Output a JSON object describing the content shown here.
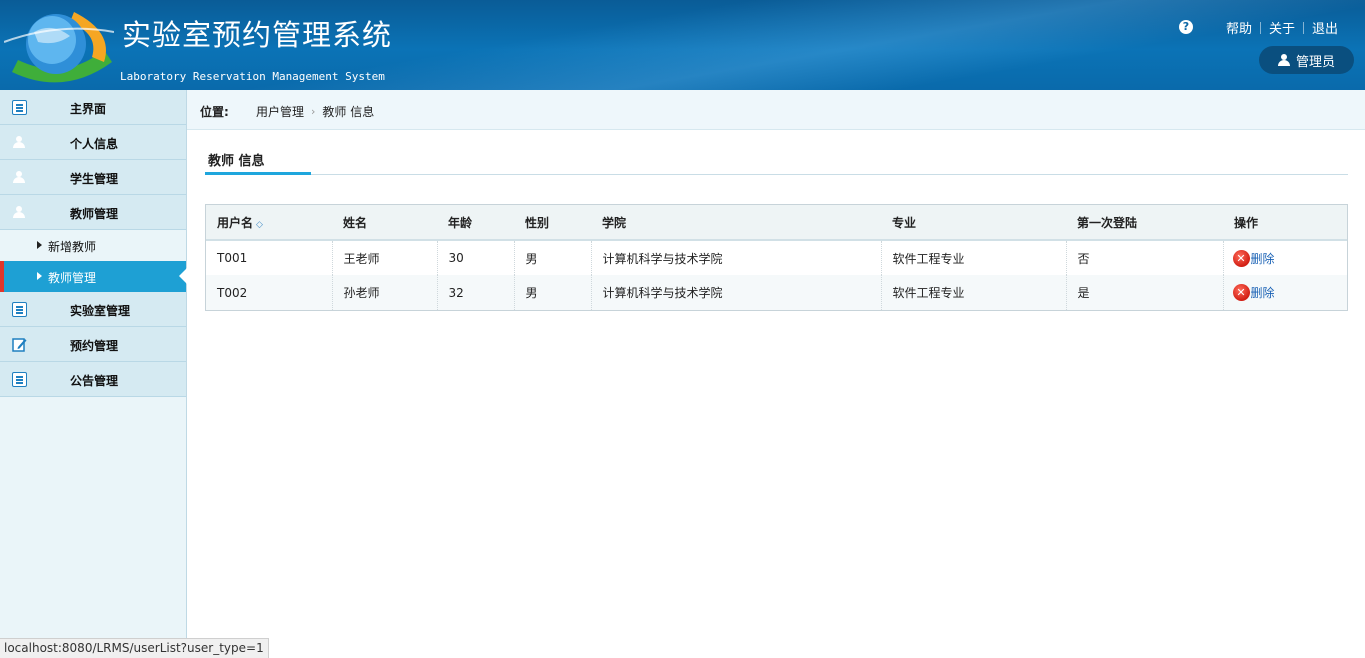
{
  "header": {
    "title": "实验室预约管理系统",
    "subtitle": "Laboratory Reservation Management System",
    "links": {
      "help": "帮助",
      "about": "关于",
      "logout": "退出"
    },
    "user": "管理员"
  },
  "sidebar": {
    "items": [
      {
        "label": "主界面",
        "icon": "list-icon"
      },
      {
        "label": "个人信息",
        "icon": "person-icon"
      },
      {
        "label": "学生管理",
        "icon": "person-icon"
      },
      {
        "label": "教师管理",
        "icon": "person-icon"
      },
      {
        "label": "实验室管理",
        "icon": "list-icon"
      },
      {
        "label": "预约管理",
        "icon": "edit-icon"
      },
      {
        "label": "公告管理",
        "icon": "list-icon"
      }
    ],
    "sub_items": [
      {
        "label": "新增教师",
        "active": false
      },
      {
        "label": "教师管理",
        "active": true
      }
    ]
  },
  "breadcrumb": {
    "label": "位置:",
    "path": [
      "用户管理",
      "教师 信息"
    ]
  },
  "section": {
    "title": "教师 信息"
  },
  "table": {
    "headers": [
      "用户名",
      "姓名",
      "年龄",
      "性别",
      "学院",
      "专业",
      "第一次登陆",
      "操作"
    ],
    "rows": [
      [
        "T001",
        "王老师",
        "30",
        "男",
        "计算机科学与技术学院",
        "软件工程专业",
        "否",
        "删除"
      ],
      [
        "T002",
        "孙老师",
        "32",
        "男",
        "计算机科学与技术学院",
        "软件工程专业",
        "是",
        "删除"
      ]
    ]
  },
  "status_url": "localhost:8080/LRMS/userList?user_type=1",
  "colors": {
    "header": "#0b73b6",
    "accent": "#1ea0d4",
    "active_marker": "#e0352b",
    "delete": "#d21f14"
  }
}
